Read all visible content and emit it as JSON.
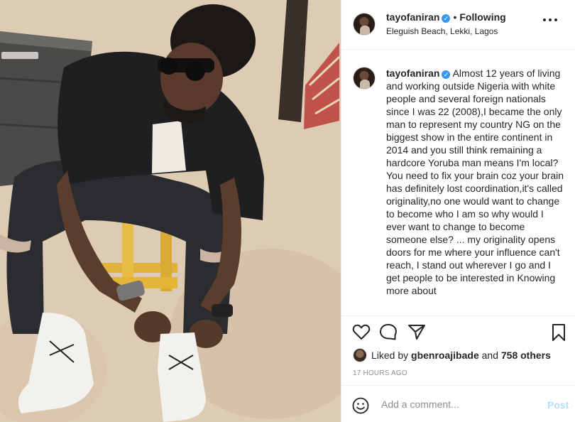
{
  "post": {
    "username": "tayofaniran",
    "verified_mark": "✓",
    "separator": "•",
    "follow_status": "Following",
    "location": "Eleguish Beach, Lekki, Lagos",
    "caption": "Almost 12 years of living and working outside Nigeria with white people and several foreign nationals since I was 22 (2008),I became the only man to represent my country NG on the biggest show in the entire continent in 2014 and you still think remaining a hardcore Yoruba man means I'm local? You need to fix your brain coz your brain has definitely lost coordination,it's called originality,no one would want to change to become who I am so why would I ever want to change to become someone else? ... my originality opens doors for me where your influence can't reach, I stand out wherever I go and I get people to be interested in Knowing more about",
    "likes_prefix": "Liked by",
    "liked_by_user": "gbenroajibade",
    "likes_conjunction": "and",
    "likes_others": "758 others",
    "timestamp": "17 HOURS AGO",
    "comment_placeholder": "Add a comment...",
    "post_label": "Post"
  },
  "icons": {
    "like": "heart-icon",
    "comment": "comment-bubble-icon",
    "share": "paper-plane-icon",
    "save": "bookmark-icon",
    "emoji": "smiley-icon",
    "more": "more-options-icon"
  },
  "colors": {
    "verified": "#3897f0",
    "post_disabled": "#b2dffc",
    "muted": "#8e8e8e",
    "text": "#262626"
  }
}
